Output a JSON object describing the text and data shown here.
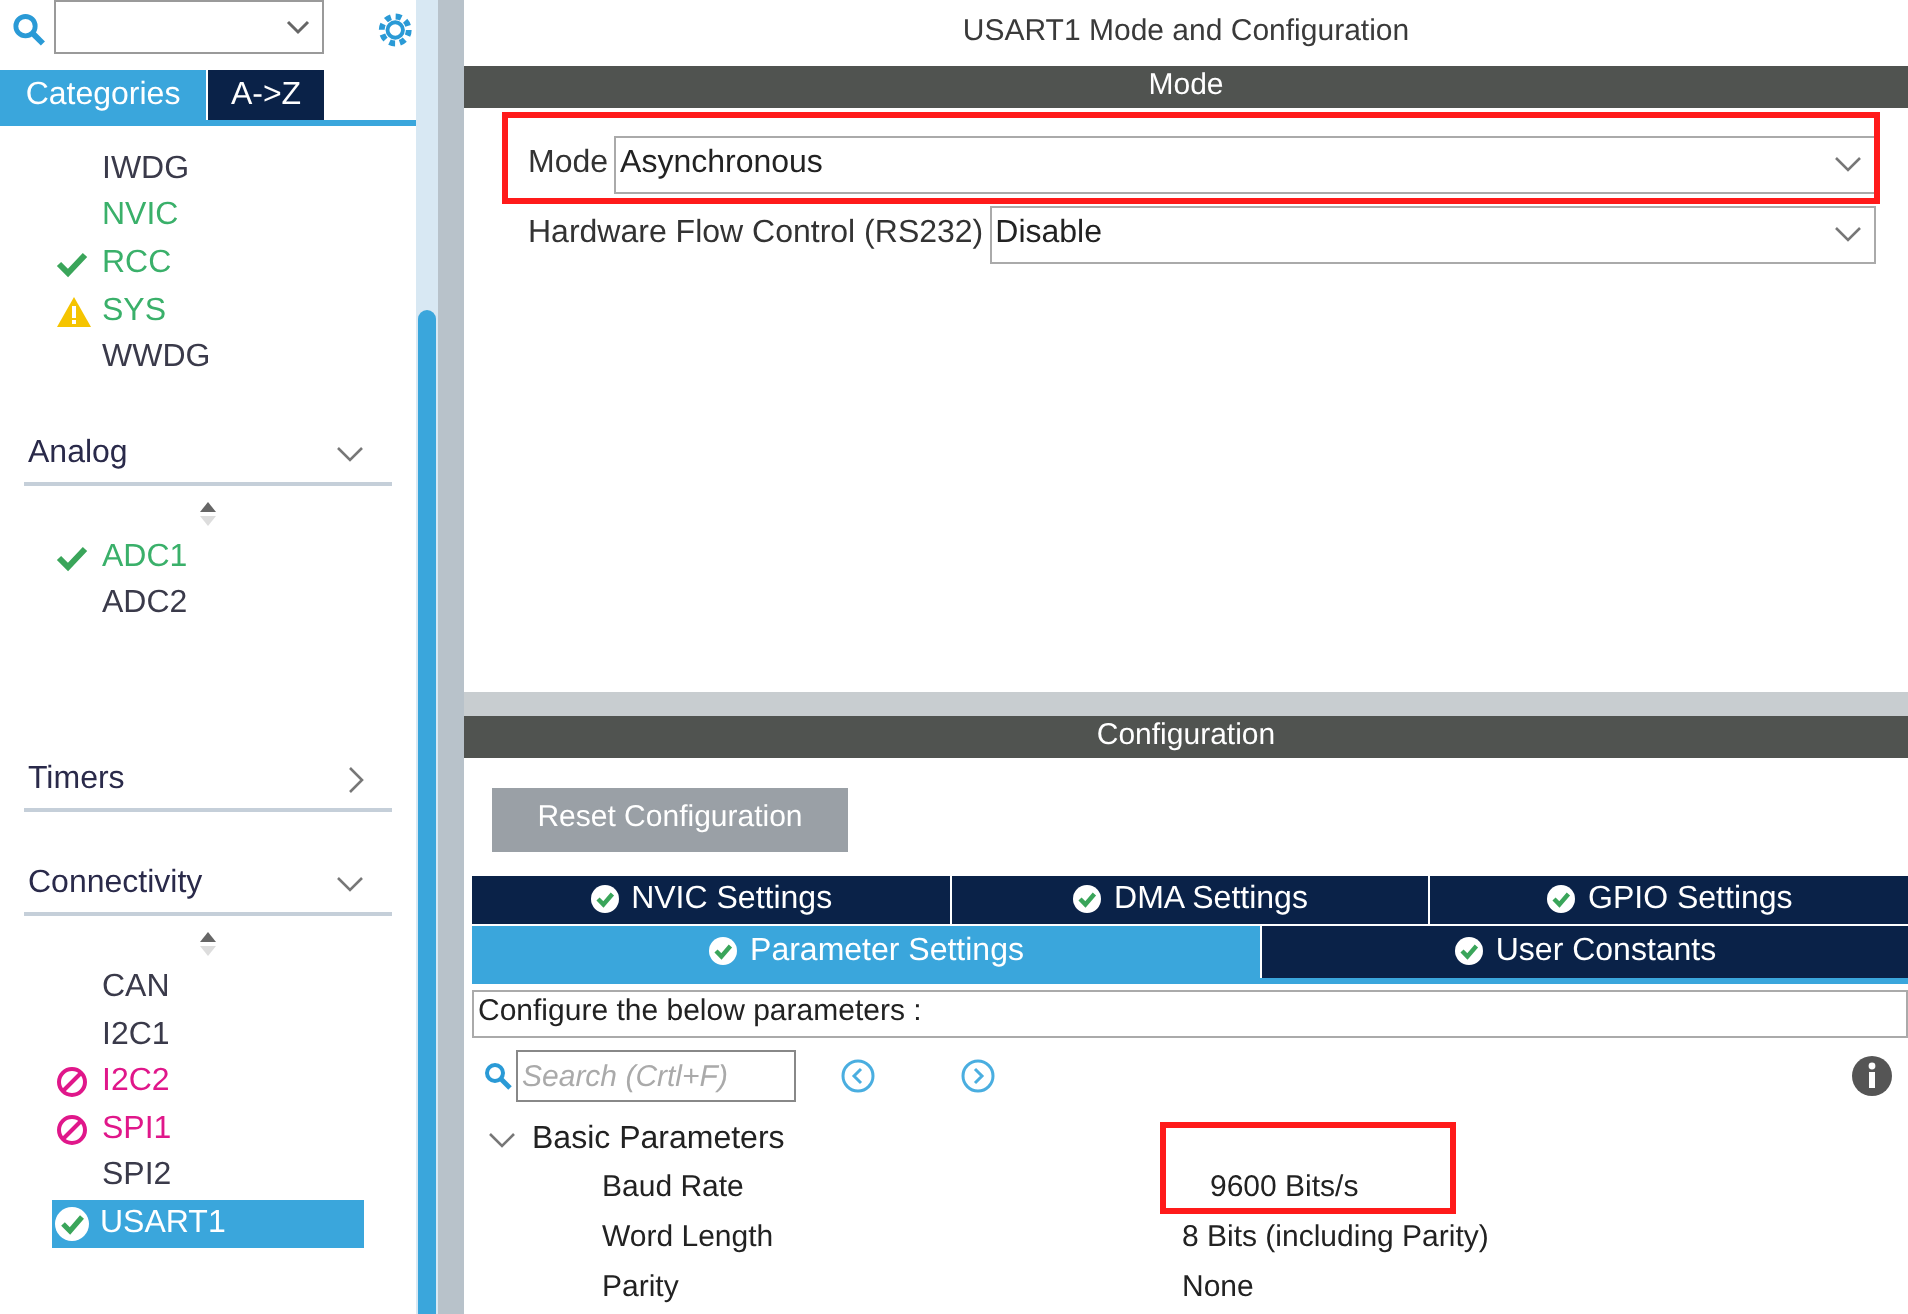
{
  "sidebar": {
    "tabs": [
      {
        "label": "Categories",
        "selected": true
      },
      {
        "label": "A->Z",
        "selected": false
      }
    ],
    "sections": [
      {
        "items": [
          {
            "label": "IWDG",
            "kind": "none",
            "selected": false
          },
          {
            "label": "NVIC",
            "kind": "available",
            "selected": false
          },
          {
            "label": "RCC",
            "kind": "ok",
            "selected": false
          },
          {
            "label": "SYS",
            "kind": "warning",
            "selected": false
          },
          {
            "label": "WWDG",
            "kind": "none",
            "selected": false
          }
        ]
      },
      {
        "title": "Analog",
        "expanded": true,
        "items": [
          {
            "label": "ADC1",
            "kind": "ok",
            "selected": false
          },
          {
            "label": "ADC2",
            "kind": "none",
            "selected": false
          }
        ]
      },
      {
        "title": "Timers",
        "expanded": false
      },
      {
        "title": "Connectivity",
        "expanded": true,
        "items": [
          {
            "label": "CAN",
            "kind": "none",
            "selected": false
          },
          {
            "label": "I2C1",
            "kind": "none",
            "selected": false
          },
          {
            "label": "I2C2",
            "kind": "blocked",
            "selected": false
          },
          {
            "label": "SPI1",
            "kind": "blocked",
            "selected": false
          },
          {
            "label": "SPI2",
            "kind": "none",
            "selected": false
          },
          {
            "label": "USART1",
            "kind": "ok",
            "selected": true
          }
        ]
      }
    ]
  },
  "title": "USART1 Mode and Configuration",
  "mode_panel": {
    "header": "Mode",
    "fields": [
      {
        "label": "Mode",
        "value": "Asynchronous",
        "highlighted": true
      },
      {
        "label": "Hardware Flow Control (RS232)",
        "value": "Disable",
        "highlighted": false
      }
    ]
  },
  "configuration": {
    "header": "Configuration",
    "reset_button": "Reset Configuration",
    "tab_rows": [
      [
        {
          "label": "NVIC Settings",
          "selected": false
        },
        {
          "label": "DMA Settings",
          "selected": false
        },
        {
          "label": "GPIO Settings",
          "selected": false
        }
      ],
      [
        {
          "label": "Parameter Settings",
          "selected": true
        },
        {
          "label": "User Constants",
          "selected": false
        }
      ]
    ],
    "hint": "Configure the below parameters :",
    "search": {
      "placeholder": "Search (Crtl+F)"
    },
    "groups": [
      {
        "title": "Basic Parameters",
        "expanded": true,
        "parameters": [
          {
            "name": "Baud Rate",
            "value": "9600 Bits/s",
            "highlighted": true
          },
          {
            "name": "Word Length",
            "value": "8 Bits (including Parity)",
            "highlighted": false
          },
          {
            "name": "Parity",
            "value": "None",
            "highlighted": false
          }
        ]
      }
    ]
  }
}
